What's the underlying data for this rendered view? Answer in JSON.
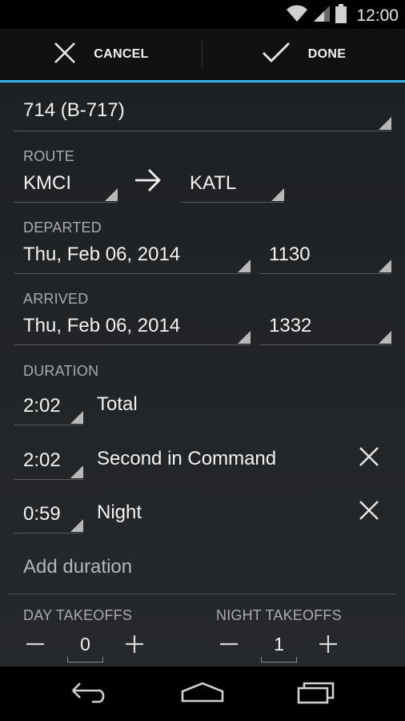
{
  "status_bar": {
    "time": "12:00",
    "icons": [
      "wifi-icon",
      "cell-signal-icon",
      "battery-icon"
    ]
  },
  "action_bar": {
    "cancel_label": "CANCEL",
    "done_label": "DONE",
    "accent_color": "#33b5e5"
  },
  "aircraft": {
    "value": "714 (B-717)"
  },
  "route": {
    "label": "ROUTE",
    "from": "KMCI",
    "to": "KATL"
  },
  "departed": {
    "label": "DEPARTED",
    "date": "Thu, Feb 06, 2014",
    "time": "1130"
  },
  "arrived": {
    "label": "ARRIVED",
    "date": "Thu, Feb 06, 2014",
    "time": "1332"
  },
  "duration": {
    "label": "DURATION",
    "rows": [
      {
        "value": "2:02",
        "type": "Total"
      },
      {
        "value": "2:02",
        "type": "Second in Command"
      },
      {
        "value": "0:59",
        "type": "Night"
      }
    ],
    "add_label": "Add duration"
  },
  "takeoffs": {
    "day_label": "DAY TAKEOFFS",
    "day_value": "0",
    "night_label": "NIGHT TAKEOFFS",
    "night_value": "1"
  },
  "nav_bar": {
    "icons": [
      "back-icon",
      "home-icon",
      "recents-icon"
    ]
  }
}
